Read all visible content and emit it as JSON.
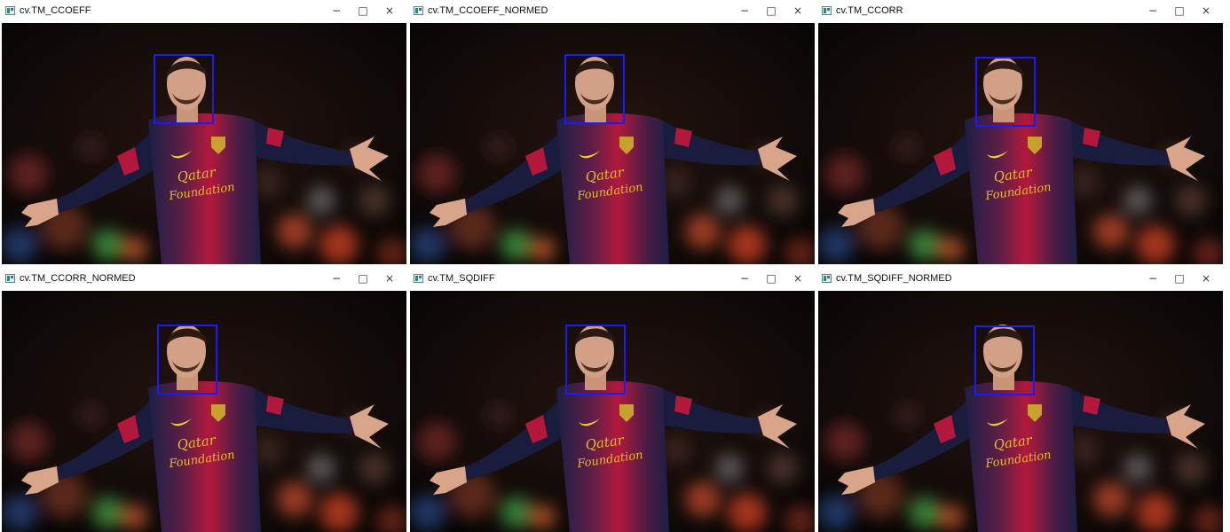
{
  "windows": [
    {
      "title": "cv.TM_CCOEFF"
    },
    {
      "title": "cv.TM_CCOEFF_NORMED"
    },
    {
      "title": "cv.TM_CCORR"
    },
    {
      "title": "cv.TM_CCORR_NORMED"
    },
    {
      "title": "cv.TM_SQDIFF"
    },
    {
      "title": "cv.TM_SQDIFF_NORMED"
    }
  ],
  "controls": {
    "minimize_glyph": "−",
    "maximize_glyph": "□",
    "close_glyph": "×",
    "minimize_icon": "minimize-icon",
    "maximize_icon": "maximize-icon",
    "close_icon": "close-icon"
  },
  "photo": {
    "sponsor_line1": "Qatar",
    "sponsor_line2": "Foundation",
    "box_color": "#1a1aff",
    "jersey_red": "#b3183c",
    "jersey_navy": "#1c1f45",
    "sponsor_color": "#e8b930"
  }
}
